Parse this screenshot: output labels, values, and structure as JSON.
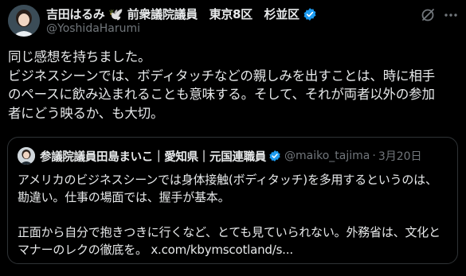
{
  "author": {
    "name": "吉田はるみ 🕊️ 前衆議院議員　東京8区　杉並区",
    "handle": "@YoshidaHarumi",
    "badge_color": "#1d9bf0"
  },
  "icons": {
    "avatar": "profile-photo",
    "grok": "grok-icon",
    "more": "more-options-icon",
    "verified": "verified-badge-icon"
  },
  "post": {
    "lines": [
      "同じ感想を持ちました。",
      "ビジネスシーンでは、ボディタッチなどの親しみを出すことは、時に相手",
      "のペースに飲み込まれることも意味する。そして、それが両者以外の参加",
      "者にどう映るか、も大切。"
    ]
  },
  "quote": {
    "author_name": "参議院議員田島まいこ｜愛知県｜元国連職員",
    "handle": "@maiko_tajima",
    "separator": "·",
    "date": "3月20日",
    "lines": [
      "アメリカのビジネスシーンでは身体接触(ボディタッチ)を多用するというのは、",
      "勘違い。仕事の場面では、握手が基本。",
      "",
      "正面から自分で抱きつきに行くなど、とても見ていられない。外務省は、文化と",
      "マナーのレクの徹底を。 x.com/kbymscotland/s..."
    ]
  }
}
